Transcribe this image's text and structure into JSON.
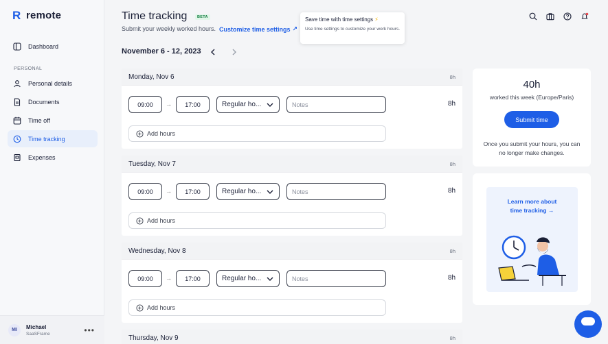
{
  "brand": {
    "name": "remote",
    "logo_glyph": "R",
    "accent": "#1e5ee6"
  },
  "sidebar": {
    "items": [
      {
        "label": "Dashboard",
        "icon": "dashboard-icon"
      },
      {
        "label": "Personal details",
        "icon": "user-icon"
      },
      {
        "label": "Documents",
        "icon": "document-icon"
      },
      {
        "label": "Time off",
        "icon": "calendar-icon"
      },
      {
        "label": "Time tracking",
        "icon": "clock-icon",
        "active": true
      },
      {
        "label": "Expenses",
        "icon": "receipt-icon"
      }
    ],
    "section_label": "PERSONAL",
    "user": {
      "initials": "MI",
      "name": "Michael",
      "org": "SaaSFrame",
      "menu": "•••"
    }
  },
  "header": {
    "title": "Time tracking",
    "beta": "BETA",
    "subtitle": "Submit your weekly worked hours.",
    "customize_link": "Customize time settings",
    "external_glyph": "↗"
  },
  "tooltip": {
    "title": "Save time with time settings",
    "bolt": "⚡",
    "body": "Use time settings to customize your work hours."
  },
  "week": {
    "range": "November 6 - 12, 2023",
    "prev": "‹",
    "next": "›"
  },
  "days": [
    {
      "title": "Monday, Nov 6",
      "total": "8h",
      "start": "09:00",
      "end": "17:00",
      "type": "Regular ho...",
      "notes_placeholder": "Notes",
      "hours": "8h",
      "add_label": "Add hours",
      "arrow": "→"
    },
    {
      "title": "Tuesday, Nov 7",
      "total": "8h",
      "start": "09:00",
      "end": "17:00",
      "type": "Regular ho...",
      "notes_placeholder": "Notes",
      "hours": "8h",
      "add_label": "Add hours",
      "arrow": "→"
    },
    {
      "title": "Wednesday, Nov 8",
      "total": "8h",
      "start": "09:00",
      "end": "17:00",
      "type": "Regular ho...",
      "notes_placeholder": "Notes",
      "hours": "8h",
      "add_label": "Add hours",
      "arrow": "→"
    },
    {
      "title": "Thursday, Nov 9",
      "total": "8h"
    }
  ],
  "summary": {
    "hours": "40h",
    "desc": "worked this week (Europe/Paris)",
    "submit": "Submit time",
    "note": "Once you submit your hours, you can no longer make changes."
  },
  "learn": {
    "line1": "Learn more about",
    "line2": "time tracking",
    "arrow": "→"
  }
}
